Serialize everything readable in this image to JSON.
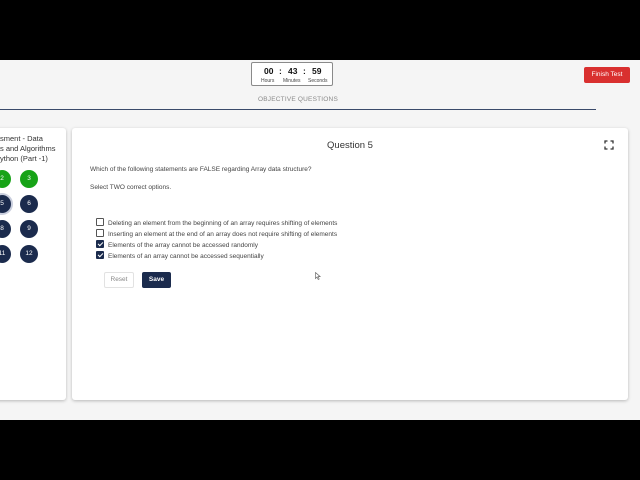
{
  "timer": {
    "hours": "00",
    "minutes": "43",
    "seconds": "59",
    "sep": ":",
    "hours_label": "Hours",
    "minutes_label": "Minutes",
    "seconds_label": "Seconds"
  },
  "header": {
    "finish_label": "Finish Test",
    "finish_color": "#d9302f"
  },
  "section": {
    "title": "OBJECTIVE QUESTIONS"
  },
  "sidebar": {
    "title_lines": [
      "sment - Data",
      "s and Algorithms",
      "ython (Part -1)"
    ],
    "questions": [
      {
        "label": "2",
        "status": "answered"
      },
      {
        "label": "3",
        "status": "answered"
      },
      {
        "label": "5",
        "status": "current"
      },
      {
        "label": "6",
        "status": "unanswered"
      },
      {
        "label": "8",
        "status": "unanswered"
      },
      {
        "label": "9",
        "status": "unanswered"
      },
      {
        "label": "11",
        "status": "unanswered"
      },
      {
        "label": "12",
        "status": "unanswered"
      }
    ]
  },
  "question": {
    "title": "Question 5",
    "text": "Which of the following statements are FALSE regarding Array data structure?",
    "hint": "Select TWO correct options.",
    "options": [
      {
        "label": "Deleting an element from the beginning of an array requires shifting of elements",
        "checked": false
      },
      {
        "label": "Inserting an element at the end of an array does not require shifting of elements",
        "checked": false
      },
      {
        "label": "Elements of the array cannot be accessed randomly",
        "checked": true
      },
      {
        "label": "Elements of an array cannot be accessed sequentially",
        "checked": true
      }
    ],
    "reset_label": "Reset",
    "save_label": "Save"
  },
  "colors": {
    "answered": "#17a317",
    "navy": "#1b2b4d"
  },
  "icons": {
    "expand": "expand-icon",
    "cursor": "mouse-pointer-icon"
  }
}
